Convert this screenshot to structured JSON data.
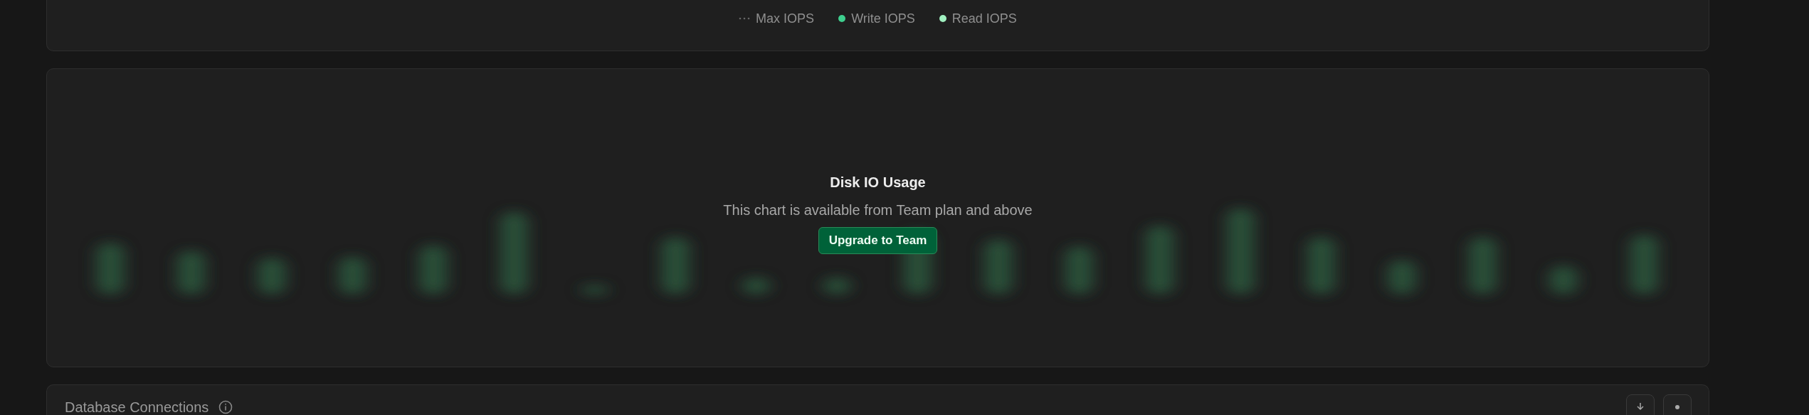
{
  "legend": [
    {
      "kind": "dotted",
      "label": "Max IOPS"
    },
    {
      "kind": "dot",
      "label": "Write IOPS",
      "color": "#3ecf8e"
    },
    {
      "kind": "dot",
      "label": "Read IOPS",
      "color": "#a0f0c0"
    }
  ],
  "locked_chart": {
    "title": "Disk IO Usage",
    "message": "This chart is available from Team plan and above",
    "button": "Upgrade to Team"
  },
  "next_card": {
    "title": "Database Connections"
  }
}
